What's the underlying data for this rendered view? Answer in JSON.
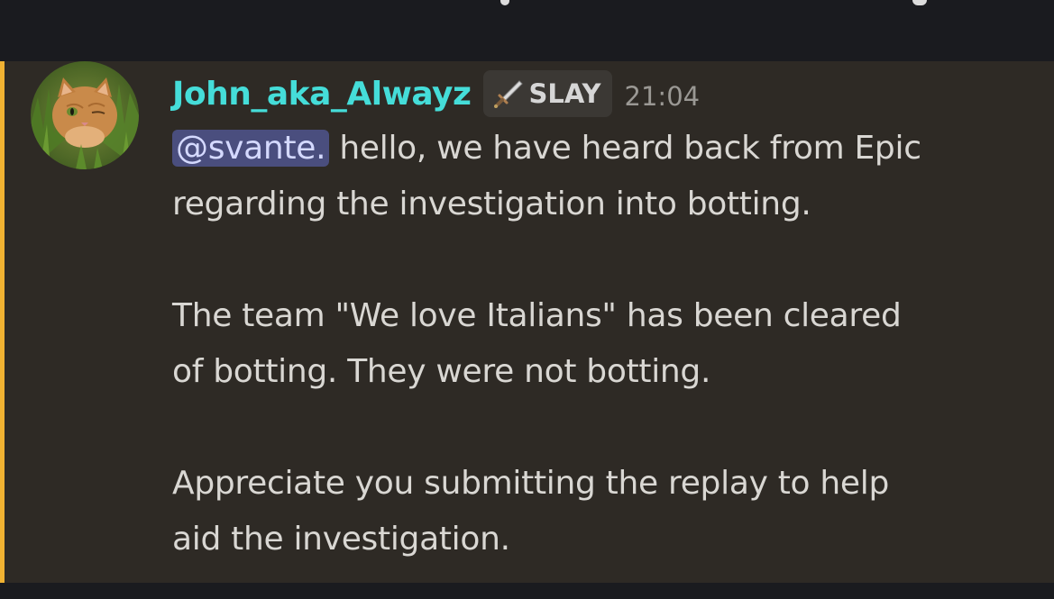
{
  "message": {
    "author": {
      "username": "John_aka_Alwayz",
      "role_badge": {
        "icon": "sword-icon",
        "label": "SLAY"
      },
      "avatar_icon": "cat-avatar"
    },
    "timestamp": "21:04",
    "mention": "@svante.",
    "paragraphs": {
      "p1_line1_rest": " hello, we have heard back from Epic",
      "p1_line2": "regarding the investigation into botting.",
      "p2_line1": "The team \"We love Italians\" has been cleared",
      "p2_line2": "of botting. They were not botting.",
      "p3_line1": "Appreciate you submitting the replay to help",
      "p3_line2": "aid the investigation."
    }
  },
  "colors": {
    "username": "#45ddd9",
    "highlight_bar": "#f0b232",
    "message_bg": "#2e2a25",
    "mention_bg": "#4a4e7e"
  }
}
